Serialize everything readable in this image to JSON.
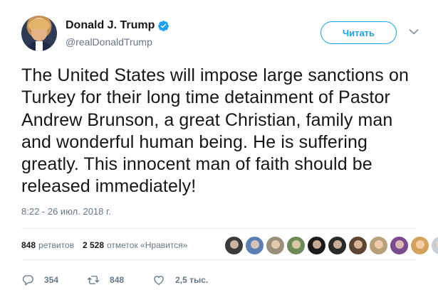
{
  "user": {
    "name": "Donald J. Trump",
    "handle": "@realDonaldTrump",
    "verified": true
  },
  "follow_button": {
    "label": "Читать"
  },
  "tweet": {
    "text": "The United States will impose large sanctions on Turkey for their long time detainment of Pastor Andrew Brunson, a great Christian, family man and wonderful human being. He is suffering greatly. This innocent man of faith should be released immediately!",
    "timestamp": "8:22 - 26 июл. 2018 г."
  },
  "stats": {
    "retweets_count": "848",
    "retweets_label": "ретвитов",
    "likes_count": "2 528",
    "likes_label": "отметок «Нравится»"
  },
  "liker_avatars": [
    {
      "color": "#3b3b3b"
    },
    {
      "color": "#5b7fb3"
    },
    {
      "color": "#9a8f7a"
    },
    {
      "color": "#6d8a5a"
    },
    {
      "color": "#1b1b1b"
    },
    {
      "color": "#2a2a2a"
    },
    {
      "color": "#5c4633"
    },
    {
      "color": "#b7a07a"
    },
    {
      "color": "#7a4b8f"
    },
    {
      "color": "#d3a35c"
    },
    {
      "color": "#c9ced3"
    }
  ],
  "actions": {
    "replies": "354",
    "retweets": "848",
    "likes": "2,5 тыс."
  },
  "colors": {
    "accent": "#1da1f2",
    "text": "#14171a",
    "muted": "#657786",
    "divider": "#e6ecf0"
  }
}
